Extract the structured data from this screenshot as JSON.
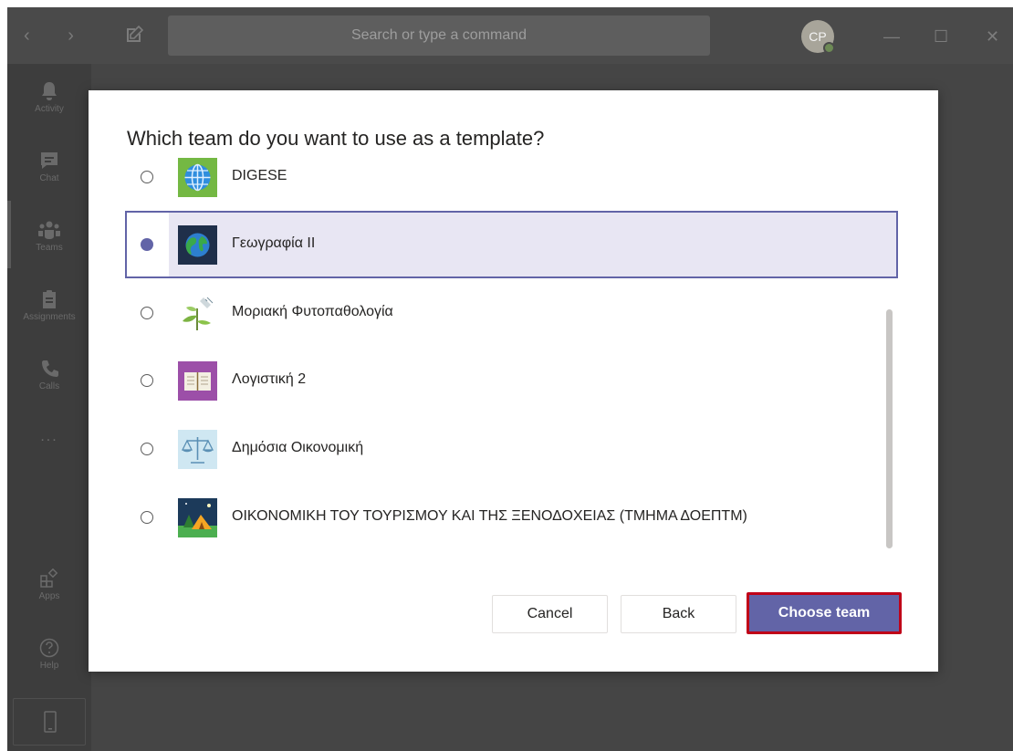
{
  "titlebar": {
    "search_placeholder": "Search or type a command",
    "avatar_initials": "CP",
    "presence_color": "#6d8a55"
  },
  "rail": {
    "items": [
      {
        "label": "Activity",
        "icon": "bell-icon"
      },
      {
        "label": "Chat",
        "icon": "chat-icon"
      },
      {
        "label": "Teams",
        "icon": "teams-icon"
      },
      {
        "label": "Assignments",
        "icon": "assignments-icon"
      },
      {
        "label": "Calls",
        "icon": "phone-icon"
      },
      {
        "label": "...",
        "icon": "more-icon"
      },
      {
        "label": "Apps",
        "icon": "apps-icon"
      },
      {
        "label": "Help",
        "icon": "help-icon"
      }
    ]
  },
  "dialog": {
    "title": "Which team do you want to use as a template?",
    "teams": [
      {
        "name": "DIGESE",
        "selected": false,
        "icon": "globe-icon"
      },
      {
        "name": "Γεωγραφία ΙΙ",
        "selected": true,
        "icon": "earth-icon"
      },
      {
        "name": "Μοριακή Φυτοπαθολογία",
        "selected": false,
        "icon": "plant-icon"
      },
      {
        "name": "Λογιστική 2",
        "selected": false,
        "icon": "book-icon"
      },
      {
        "name": "Δημόσια Οικονομική",
        "selected": false,
        "icon": "scales-icon"
      },
      {
        "name": "ΟΙΚΟΝΟΜΙΚΗ ΤΟΥ ΤΟΥΡΙΣΜΟΥ ΚΑΙ ΤΗΣ ΞΕΝΟΔΟΧΕΙΑΣ (ΤΜΗΜΑ ΔΟΕΠΤΜ)",
        "selected": false,
        "icon": "tent-icon"
      }
    ],
    "cancel_label": "Cancel",
    "back_label": "Back",
    "choose_label": "Choose team",
    "accent_color": "#6264a7",
    "highlight_color": "#c00018"
  }
}
